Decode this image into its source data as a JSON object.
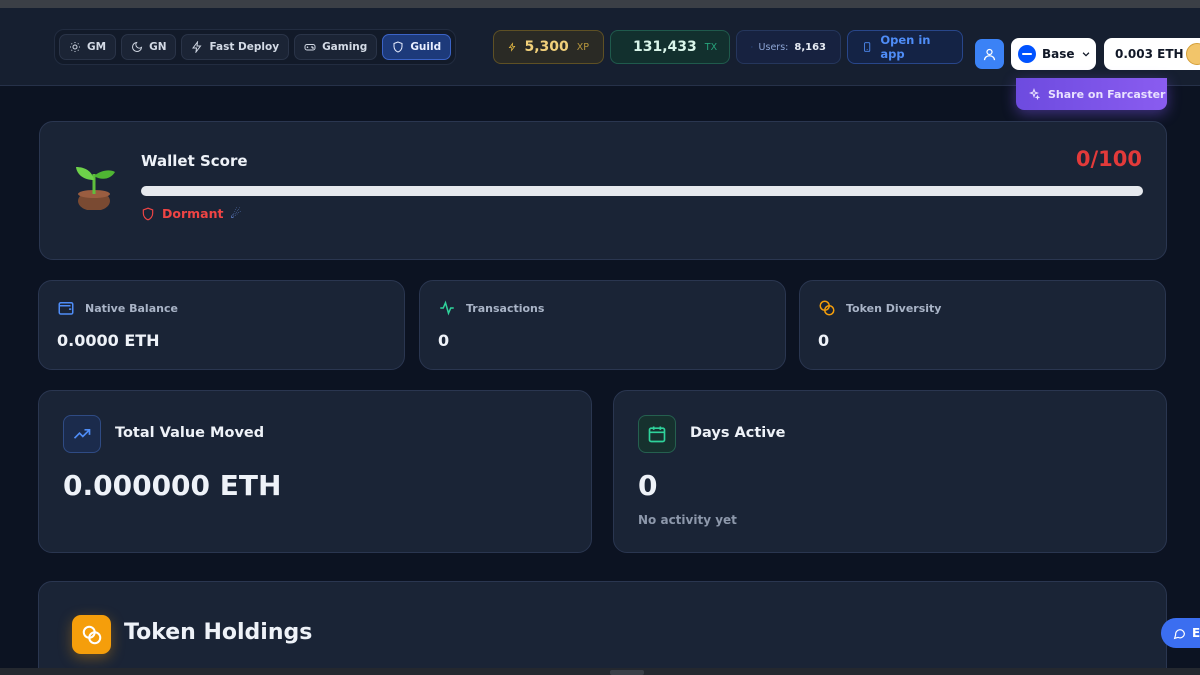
{
  "nav": {
    "items": [
      {
        "label": "GM",
        "icon": "sun-icon",
        "active": false
      },
      {
        "label": "GN",
        "icon": "moon-icon",
        "active": false
      },
      {
        "label": "Fast Deploy",
        "icon": "lightning-icon",
        "active": false
      },
      {
        "label": "Gaming",
        "icon": "gamepad-icon",
        "active": false
      },
      {
        "label": "Guild",
        "icon": "shield-icon",
        "active": true
      }
    ]
  },
  "stats": {
    "xp_value": "5,300",
    "xp_unit": "XP",
    "tx_value": "131,433",
    "tx_unit": "TX",
    "users_label": "Users:",
    "users_value": "8,163"
  },
  "header": {
    "open_app_label": "Open in app",
    "network_label": "Base",
    "balance_label": "0.003 ETH",
    "share_label": "Share on Farcaster"
  },
  "score": {
    "title": "Wallet Score",
    "value": "0/100",
    "progress": 0,
    "status": "Dormant"
  },
  "metrics": {
    "native_balance": {
      "label": "Native Balance",
      "value": "0.0000 ETH"
    },
    "transactions": {
      "label": "Transactions",
      "value": "0"
    },
    "token_diversity": {
      "label": "Token Diversity",
      "value": "0"
    }
  },
  "value_moved": {
    "title": "Total Value Moved",
    "value": "0.000000 ETH"
  },
  "days_active": {
    "title": "Days Active",
    "value": "0",
    "subtitle": "No activity yet"
  },
  "holdings": {
    "title": "Token Holdings"
  },
  "chat": {
    "label": "E"
  },
  "colors": {
    "background": "#0c1322",
    "card": "#1a2436",
    "accent_blue": "#3b82f6",
    "danger": "#e23a3a",
    "xp_gold": "#f3c546",
    "tx_green": "#2fd39b",
    "farcaster_purple": "#7c54f0",
    "holdings_orange": "#f59e0b"
  }
}
